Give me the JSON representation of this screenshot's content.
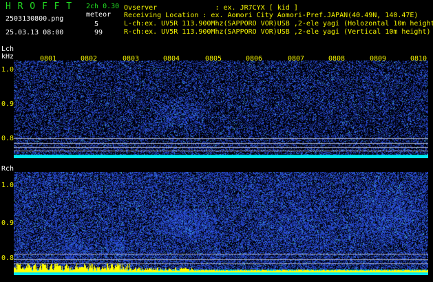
{
  "app": {
    "title": "H R O F F T",
    "version": "2ch 0.30",
    "mode": "meteor",
    "filename": "2503130800.png",
    "datetime": "25.03.13 08:00",
    "count_l": "5",
    "count_r": "99"
  },
  "info": {
    "observer": "Ovserver              : ex. JR7CYX [ kid ]",
    "location": "Receiving Location : ex. Aomori City Aomori-Pref.JAPAN(40.49N, 140.47E)",
    "lch": "L-ch:ex. UV5R 113.900Mhz(SAPPORO VOR)USB ,2-ele yagi (Holozontal 10m height",
    "rch": "R-ch:ex. UV5R 113.900Mhz(SAPPORO VOR)USB ,2-ele yagi (Vertical 10m height)"
  },
  "lch": {
    "label": "Lch",
    "unit": "kHz"
  },
  "rch": {
    "label": "Rch"
  },
  "time_ticks": [
    "0801",
    "0802",
    "0803",
    "0804",
    "0805",
    "0806",
    "0807",
    "0808",
    "0809",
    "0810"
  ],
  "freq_ticks_l": [
    "1.0",
    "0.9",
    "0.8"
  ],
  "freq_ticks_r": [
    "1.0",
    "0.9",
    "0.8"
  ],
  "colors": {
    "background": "#000000",
    "label_green": "#22dd22",
    "label_yellow": "#f4f400",
    "noise_blue": "#1a2fc8",
    "baseline_cyan": "#00e8f0",
    "baseline_yellow": "#ffff00"
  }
}
